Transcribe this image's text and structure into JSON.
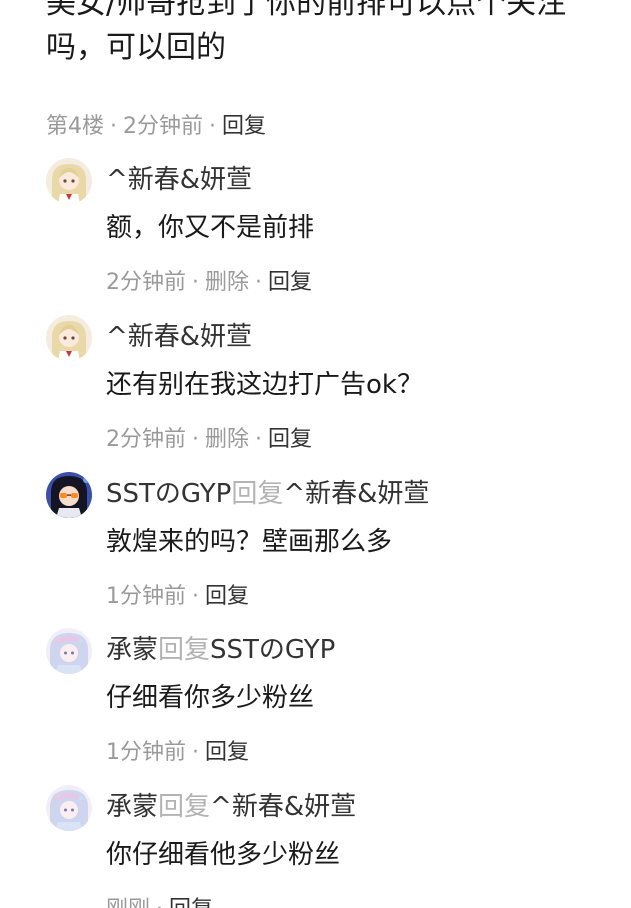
{
  "parent_comment": {
    "text_partial": "美女/帅哥抢到了你的前排可以点个关注吗，可以回的",
    "floor": "第4楼",
    "time": "2分钟前",
    "reply_label": "回复"
  },
  "meta_separator": "·",
  "replies": [
    {
      "username": "^新春&妍萱",
      "text": "额，你又不是前排",
      "time": "2分钟前",
      "delete_label": "删除",
      "reply_label": "回复",
      "avatar": "anime-blonde-girl-avatar"
    },
    {
      "username": "^新春&妍萱",
      "text": "还有别在我这边打广告ok？",
      "time": "2分钟前",
      "delete_label": "删除",
      "reply_label": "回复",
      "avatar": "anime-blonde-girl-avatar"
    },
    {
      "username": "SSTのGYP",
      "reply_word": "回复",
      "reply_target": "^新春&妍萱",
      "text": "敦煌来的吗？壁画那么多",
      "time": "1分钟前",
      "reply_label": "回复",
      "avatar": "anime-glasses-girl-avatar"
    },
    {
      "username": "承蒙",
      "reply_word": "回复",
      "reply_target": "SSTのGYP",
      "text": "仔细看你多少粉丝",
      "time": "1分钟前",
      "reply_label": "回复",
      "avatar": "pastel-girl-avatar"
    },
    {
      "username": "承蒙",
      "reply_word": "回复",
      "reply_target": "^新春&妍萱",
      "text": "你仔细看他多少粉丝",
      "time": "刚刚",
      "reply_label": "回复",
      "avatar": "pastel-girl-avatar"
    }
  ],
  "colors": {
    "text_primary": "#1a1a1a",
    "text_secondary": "#9a9a9a",
    "reply_word": "#b3b3b3",
    "action": "#333333"
  }
}
